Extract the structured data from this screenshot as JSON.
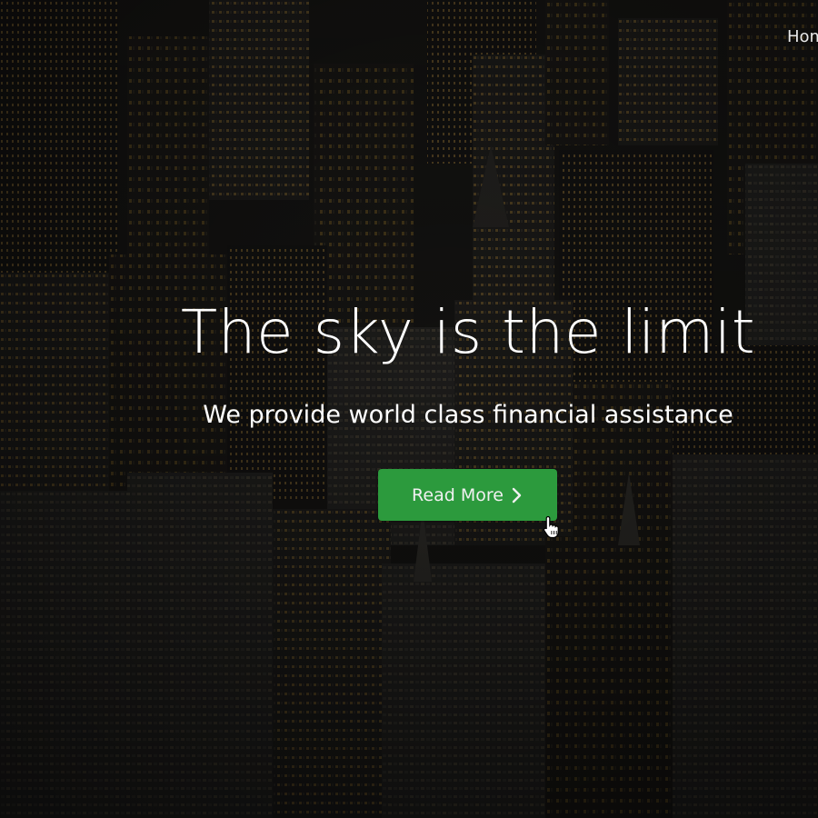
{
  "nav": {
    "home_label": "Home"
  },
  "hero": {
    "title": "The sky is the limit",
    "subtitle": "We provide world class financial assistance",
    "cta_label": "Read More",
    "cta_icon": "chevron-right-icon"
  },
  "colors": {
    "cta_background": "#2c9a3d",
    "text": "#ffffff",
    "background": "#161514",
    "window_light": "#c9a24a"
  },
  "background": {
    "description_icon": "city-skyline-night-image"
  }
}
